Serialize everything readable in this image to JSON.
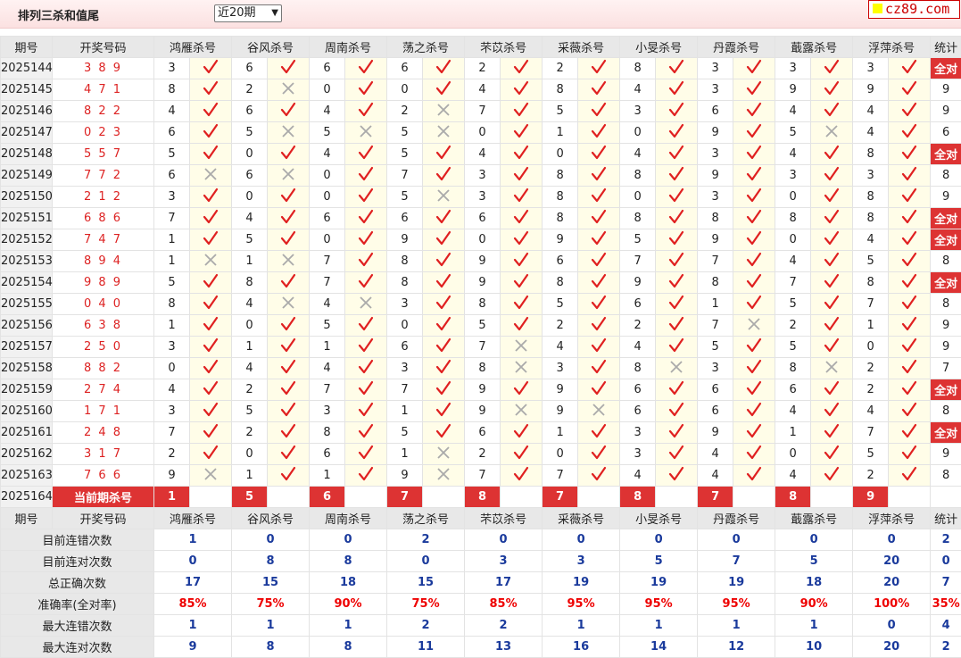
{
  "header": {
    "title": "排列三杀和值尾",
    "period_select": "近20期",
    "logo": "cz89.com"
  },
  "columns": [
    "期号",
    "开奖号码",
    "鸿雁杀号",
    "谷风杀号",
    "周南杀号",
    "荡之杀号",
    "芣苡杀号",
    "采薇杀号",
    "小旻杀号",
    "丹霞杀号",
    "蕺露杀号",
    "浮萍杀号",
    "统计"
  ],
  "rows": [
    {
      "period": "2025144",
      "draw": "389",
      "kills": [
        [
          "3",
          1
        ],
        [
          "6",
          1
        ],
        [
          "6",
          1
        ],
        [
          "6",
          1
        ],
        [
          "2",
          1
        ],
        [
          "2",
          1
        ],
        [
          "8",
          1
        ],
        [
          "3",
          1
        ],
        [
          "3",
          1
        ],
        [
          "3",
          1
        ]
      ],
      "stat": "全对"
    },
    {
      "period": "2025145",
      "draw": "471",
      "kills": [
        [
          "8",
          1
        ],
        [
          "2",
          0
        ],
        [
          "0",
          1
        ],
        [
          "0",
          1
        ],
        [
          "4",
          1
        ],
        [
          "8",
          1
        ],
        [
          "4",
          1
        ],
        [
          "3",
          1
        ],
        [
          "9",
          1
        ],
        [
          "9",
          1
        ]
      ],
      "stat": "9"
    },
    {
      "period": "2025146",
      "draw": "822",
      "kills": [
        [
          "4",
          1
        ],
        [
          "6",
          1
        ],
        [
          "4",
          1
        ],
        [
          "2",
          0
        ],
        [
          "7",
          1
        ],
        [
          "5",
          1
        ],
        [
          "3",
          1
        ],
        [
          "6",
          1
        ],
        [
          "4",
          1
        ],
        [
          "4",
          1
        ]
      ],
      "stat": "9"
    },
    {
      "period": "2025147",
      "draw": "023",
      "kills": [
        [
          "6",
          1
        ],
        [
          "5",
          0
        ],
        [
          "5",
          0
        ],
        [
          "5",
          0
        ],
        [
          "0",
          1
        ],
        [
          "1",
          1
        ],
        [
          "0",
          1
        ],
        [
          "9",
          1
        ],
        [
          "5",
          0
        ],
        [
          "4",
          1
        ]
      ],
      "stat": "6"
    },
    {
      "period": "2025148",
      "draw": "557",
      "kills": [
        [
          "5",
          1
        ],
        [
          "0",
          1
        ],
        [
          "4",
          1
        ],
        [
          "5",
          1
        ],
        [
          "4",
          1
        ],
        [
          "0",
          1
        ],
        [
          "4",
          1
        ],
        [
          "3",
          1
        ],
        [
          "4",
          1
        ],
        [
          "8",
          1
        ]
      ],
      "stat": "全对"
    },
    {
      "period": "2025149",
      "draw": "772",
      "kills": [
        [
          "6",
          0
        ],
        [
          "6",
          0
        ],
        [
          "0",
          1
        ],
        [
          "7",
          1
        ],
        [
          "3",
          1
        ],
        [
          "8",
          1
        ],
        [
          "8",
          1
        ],
        [
          "9",
          1
        ],
        [
          "3",
          1
        ],
        [
          "3",
          1
        ]
      ],
      "stat": "8"
    },
    {
      "period": "2025150",
      "draw": "212",
      "kills": [
        [
          "3",
          1
        ],
        [
          "0",
          1
        ],
        [
          "0",
          1
        ],
        [
          "5",
          0
        ],
        [
          "3",
          1
        ],
        [
          "8",
          1
        ],
        [
          "0",
          1
        ],
        [
          "3",
          1
        ],
        [
          "0",
          1
        ],
        [
          "8",
          1
        ]
      ],
      "stat": "9"
    },
    {
      "period": "2025151",
      "draw": "686",
      "kills": [
        [
          "7",
          1
        ],
        [
          "4",
          1
        ],
        [
          "6",
          1
        ],
        [
          "6",
          1
        ],
        [
          "6",
          1
        ],
        [
          "8",
          1
        ],
        [
          "8",
          1
        ],
        [
          "8",
          1
        ],
        [
          "8",
          1
        ],
        [
          "8",
          1
        ]
      ],
      "stat": "全对"
    },
    {
      "period": "2025152",
      "draw": "747",
      "kills": [
        [
          "1",
          1
        ],
        [
          "5",
          1
        ],
        [
          "0",
          1
        ],
        [
          "9",
          1
        ],
        [
          "0",
          1
        ],
        [
          "9",
          1
        ],
        [
          "5",
          1
        ],
        [
          "9",
          1
        ],
        [
          "0",
          1
        ],
        [
          "4",
          1
        ]
      ],
      "stat": "全对"
    },
    {
      "period": "2025153",
      "draw": "894",
      "kills": [
        [
          "1",
          0
        ],
        [
          "1",
          0
        ],
        [
          "7",
          1
        ],
        [
          "8",
          1
        ],
        [
          "9",
          1
        ],
        [
          "6",
          1
        ],
        [
          "7",
          1
        ],
        [
          "7",
          1
        ],
        [
          "4",
          1
        ],
        [
          "5",
          1
        ]
      ],
      "stat": "8"
    },
    {
      "period": "2025154",
      "draw": "989",
      "kills": [
        [
          "5",
          1
        ],
        [
          "8",
          1
        ],
        [
          "7",
          1
        ],
        [
          "8",
          1
        ],
        [
          "9",
          1
        ],
        [
          "8",
          1
        ],
        [
          "9",
          1
        ],
        [
          "8",
          1
        ],
        [
          "7",
          1
        ],
        [
          "8",
          1
        ]
      ],
      "stat": "全对"
    },
    {
      "period": "2025155",
      "draw": "040",
      "kills": [
        [
          "8",
          1
        ],
        [
          "4",
          0
        ],
        [
          "4",
          0
        ],
        [
          "3",
          1
        ],
        [
          "8",
          1
        ],
        [
          "5",
          1
        ],
        [
          "6",
          1
        ],
        [
          "1",
          1
        ],
        [
          "5",
          1
        ],
        [
          "7",
          1
        ]
      ],
      "stat": "8"
    },
    {
      "period": "2025156",
      "draw": "638",
      "kills": [
        [
          "1",
          1
        ],
        [
          "0",
          1
        ],
        [
          "5",
          1
        ],
        [
          "0",
          1
        ],
        [
          "5",
          1
        ],
        [
          "2",
          1
        ],
        [
          "2",
          1
        ],
        [
          "7",
          0
        ],
        [
          "2",
          1
        ],
        [
          "1",
          1
        ]
      ],
      "stat": "9"
    },
    {
      "period": "2025157",
      "draw": "250",
      "kills": [
        [
          "3",
          1
        ],
        [
          "1",
          1
        ],
        [
          "1",
          1
        ],
        [
          "6",
          1
        ],
        [
          "7",
          0
        ],
        [
          "4",
          1
        ],
        [
          "4",
          1
        ],
        [
          "5",
          1
        ],
        [
          "5",
          1
        ],
        [
          "0",
          1
        ]
      ],
      "stat": "9"
    },
    {
      "period": "2025158",
      "draw": "882",
      "kills": [
        [
          "0",
          1
        ],
        [
          "4",
          1
        ],
        [
          "4",
          1
        ],
        [
          "3",
          1
        ],
        [
          "8",
          0
        ],
        [
          "3",
          1
        ],
        [
          "8",
          0
        ],
        [
          "3",
          1
        ],
        [
          "8",
          0
        ],
        [
          "2",
          1
        ]
      ],
      "stat": "7"
    },
    {
      "period": "2025159",
      "draw": "274",
      "kills": [
        [
          "4",
          1
        ],
        [
          "2",
          1
        ],
        [
          "7",
          1
        ],
        [
          "7",
          1
        ],
        [
          "9",
          1
        ],
        [
          "9",
          1
        ],
        [
          "6",
          1
        ],
        [
          "6",
          1
        ],
        [
          "6",
          1
        ],
        [
          "2",
          1
        ]
      ],
      "stat": "全对"
    },
    {
      "period": "2025160",
      "draw": "171",
      "kills": [
        [
          "3",
          1
        ],
        [
          "5",
          1
        ],
        [
          "3",
          1
        ],
        [
          "1",
          1
        ],
        [
          "9",
          0
        ],
        [
          "9",
          0
        ],
        [
          "6",
          1
        ],
        [
          "6",
          1
        ],
        [
          "4",
          1
        ],
        [
          "4",
          1
        ]
      ],
      "stat": "8"
    },
    {
      "period": "2025161",
      "draw": "248",
      "kills": [
        [
          "7",
          1
        ],
        [
          "2",
          1
        ],
        [
          "8",
          1
        ],
        [
          "5",
          1
        ],
        [
          "6",
          1
        ],
        [
          "1",
          1
        ],
        [
          "3",
          1
        ],
        [
          "9",
          1
        ],
        [
          "1",
          1
        ],
        [
          "7",
          1
        ]
      ],
      "stat": "全对"
    },
    {
      "period": "2025162",
      "draw": "317",
      "kills": [
        [
          "2",
          1
        ],
        [
          "0",
          1
        ],
        [
          "6",
          1
        ],
        [
          "1",
          0
        ],
        [
          "2",
          1
        ],
        [
          "0",
          1
        ],
        [
          "3",
          1
        ],
        [
          "4",
          1
        ],
        [
          "0",
          1
        ],
        [
          "5",
          1
        ]
      ],
      "stat": "9"
    },
    {
      "period": "2025163",
      "draw": "766",
      "kills": [
        [
          "9",
          0
        ],
        [
          "1",
          1
        ],
        [
          "1",
          1
        ],
        [
          "9",
          0
        ],
        [
          "7",
          1
        ],
        [
          "7",
          1
        ],
        [
          "4",
          1
        ],
        [
          "4",
          1
        ],
        [
          "4",
          1
        ],
        [
          "2",
          1
        ]
      ],
      "stat": "8"
    }
  ],
  "current": {
    "period": "2025164",
    "label": "当前期杀号",
    "predictions": [
      "1",
      "5",
      "6",
      "7",
      "8",
      "7",
      "8",
      "7",
      "8",
      "9"
    ]
  },
  "stats": [
    {
      "label": "目前连错次数",
      "values": [
        "1",
        "0",
        "0",
        "2",
        "0",
        "0",
        "0",
        "0",
        "0",
        "0",
        "2"
      ],
      "rate": false
    },
    {
      "label": "目前连对次数",
      "values": [
        "0",
        "8",
        "8",
        "0",
        "3",
        "3",
        "5",
        "7",
        "5",
        "20",
        "0"
      ],
      "rate": false
    },
    {
      "label": "总正确次数",
      "values": [
        "17",
        "15",
        "18",
        "15",
        "17",
        "19",
        "19",
        "19",
        "18",
        "20",
        "7"
      ],
      "rate": false
    },
    {
      "label": "准确率(全对率)",
      "values": [
        "85%",
        "75%",
        "90%",
        "75%",
        "85%",
        "95%",
        "95%",
        "95%",
        "90%",
        "100%",
        "35%"
      ],
      "rate": true
    },
    {
      "label": "最大连错次数",
      "values": [
        "1",
        "1",
        "1",
        "2",
        "2",
        "1",
        "1",
        "1",
        "1",
        "0",
        "4"
      ],
      "rate": false
    },
    {
      "label": "最大连对次数",
      "values": [
        "9",
        "8",
        "8",
        "11",
        "13",
        "16",
        "14",
        "12",
        "10",
        "20",
        "2"
      ],
      "rate": false
    }
  ],
  "colors": {
    "accent": "#d33",
    "check": "#e02020",
    "cross": "#aaaaaa",
    "stat": "#1a3a9c"
  }
}
